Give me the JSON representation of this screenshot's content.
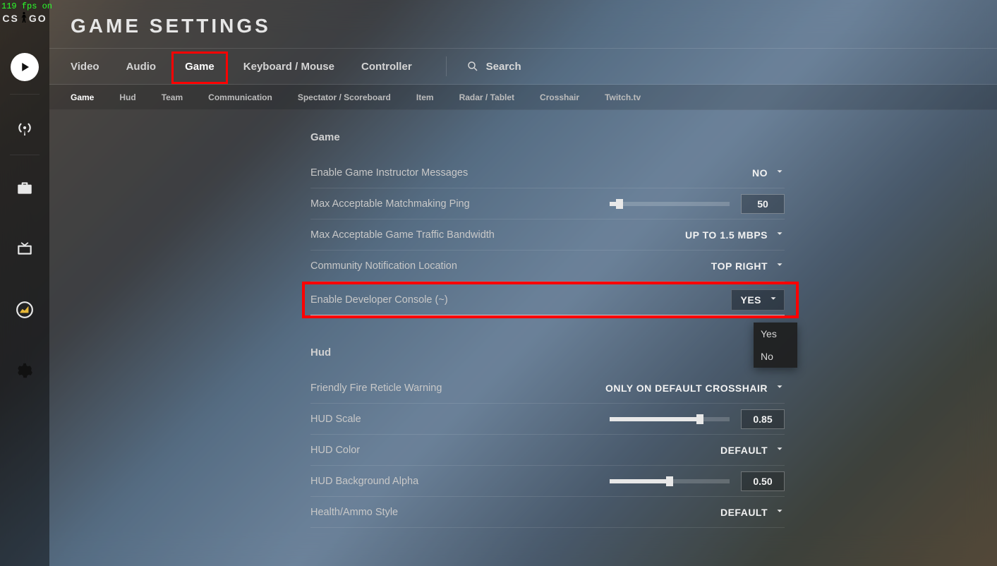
{
  "fps_overlay": "119 fps on",
  "logo_left": "CS",
  "logo_right": "GO",
  "page_title": "GAME SETTINGS",
  "main_tabs": {
    "video": "Video",
    "audio": "Audio",
    "game": "Game",
    "kbm": "Keyboard / Mouse",
    "controller": "Controller"
  },
  "search_label": "Search",
  "sub_tabs": {
    "game": "Game",
    "hud": "Hud",
    "team": "Team",
    "comm": "Communication",
    "spec": "Spectator / Scoreboard",
    "item": "Item",
    "radar": "Radar / Tablet",
    "cross": "Crosshair",
    "twitch": "Twitch.tv"
  },
  "sections": {
    "game": {
      "title": "Game",
      "rows": {
        "instructor": {
          "label": "Enable Game Instructor Messages",
          "value": "NO"
        },
        "ping": {
          "label": "Max Acceptable Matchmaking Ping",
          "value": "50",
          "slider_pct": 8
        },
        "bandwidth": {
          "label": "Max Acceptable Game Traffic Bandwidth",
          "value": "UP TO 1.5 MBPS"
        },
        "notif": {
          "label": "Community Notification Location",
          "value": "TOP RIGHT"
        },
        "devconsole": {
          "label": "Enable Developer Console (~)",
          "value": "YES",
          "options": [
            "Yes",
            "No"
          ]
        }
      }
    },
    "hud": {
      "title": "Hud",
      "rows": {
        "ffwarn": {
          "label": "Friendly Fire Reticle Warning",
          "value": "ONLY ON DEFAULT CROSSHAIR"
        },
        "scale": {
          "label": "HUD Scale",
          "value": "0.85",
          "slider_pct": 75
        },
        "color": {
          "label": "HUD Color",
          "value": "DEFAULT"
        },
        "bgalpha": {
          "label": "HUD Background Alpha",
          "value": "0.50",
          "slider_pct": 50
        },
        "health": {
          "label": "Health/Ammo Style",
          "value": "DEFAULT"
        }
      }
    }
  }
}
